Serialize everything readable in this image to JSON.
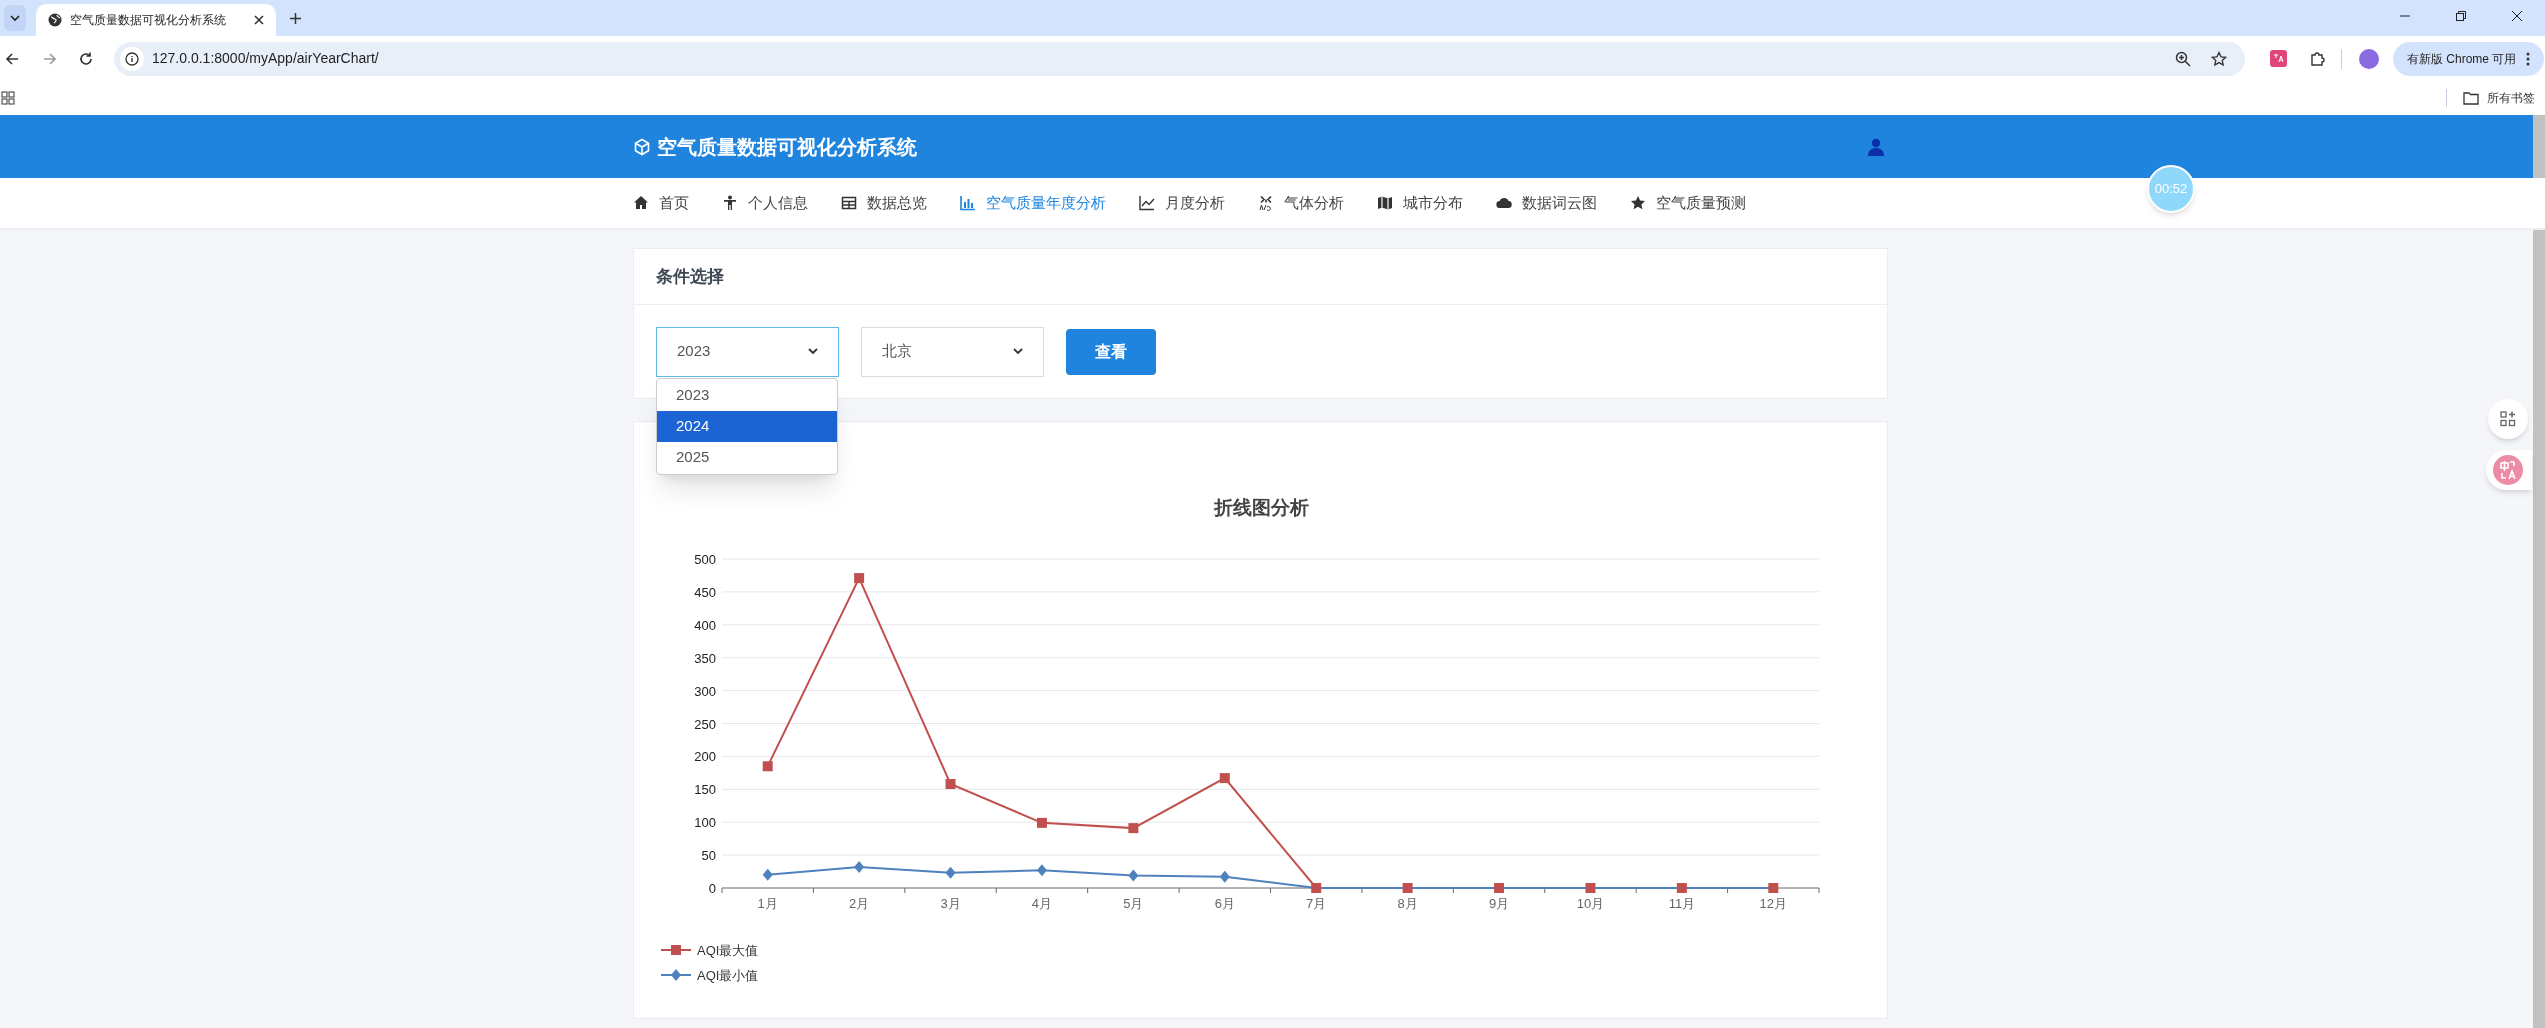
{
  "browser": {
    "tabs": [
      {
        "title": "空气质量数据可视化分析系统",
        "selected": true
      }
    ],
    "url": "127.0.0.1:8000/myApp/airYearChart/",
    "update_button": "有新版 Chrome 可用",
    "bookmarks_label": "所有书签"
  },
  "app": {
    "title": "空气质量数据可视化分析系统",
    "nav": [
      {
        "label": "首页",
        "selected": false
      },
      {
        "label": "个人信息",
        "selected": false
      },
      {
        "label": "数据总览",
        "selected": false
      },
      {
        "label": "空气质量年度分析",
        "selected": true
      },
      {
        "label": "月度分析",
        "selected": false
      },
      {
        "label": "气体分析",
        "selected": false
      },
      {
        "label": "城市分布",
        "selected": false
      },
      {
        "label": "数据词云图",
        "selected": false
      },
      {
        "label": "空气质量预测",
        "selected": false
      }
    ]
  },
  "timer": "00:52",
  "filter_card": {
    "title": "条件选择",
    "year_select": "2023",
    "year_options": [
      {
        "label": "2023",
        "selected": false
      },
      {
        "label": "2024",
        "selected": true
      },
      {
        "label": "2025",
        "selected": false
      }
    ],
    "city_select": "北京",
    "button": "查看"
  },
  "chart_card": {
    "chart_data": {
      "type": "line",
      "title": "折线图分析",
      "categories": [
        "1月",
        "2月",
        "3月",
        "4月",
        "5月",
        "6月",
        "7月",
        "8月",
        "9月",
        "10月",
        "11月",
        "12月"
      ],
      "series": [
        {
          "name": "AQI最大值",
          "color": "#c0504d",
          "marker": "square",
          "values": [
            185,
            471,
            158,
            99,
            91,
            167,
            0,
            0,
            0,
            0,
            0,
            0
          ]
        },
        {
          "name": "AQI最小值",
          "color": "#4f81bd",
          "marker": "diamond",
          "values": [
            20,
            32,
            23,
            27,
            19,
            17,
            0,
            0,
            0,
            0,
            0,
            0
          ]
        }
      ],
      "grid": true,
      "legend": true,
      "ylim": [
        0,
        500
      ],
      "yticks": [
        0,
        50,
        100,
        150,
        200,
        250,
        300,
        350,
        400,
        450,
        500
      ]
    }
  }
}
